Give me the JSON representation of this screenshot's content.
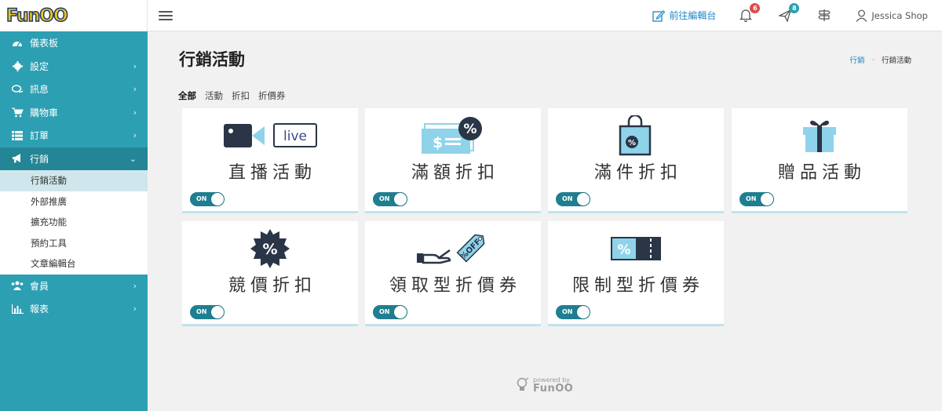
{
  "logo": {
    "text": "FunOO"
  },
  "sidebar": {
    "items": [
      {
        "label": "儀表板",
        "icon": "dashboard-icon",
        "has_children": false
      },
      {
        "label": "設定",
        "icon": "gear-icon",
        "has_children": true
      },
      {
        "label": "訊息",
        "icon": "chat-icon",
        "has_children": true
      },
      {
        "label": "購物車",
        "icon": "cart-icon",
        "has_children": true
      },
      {
        "label": "訂單",
        "icon": "list-icon",
        "has_children": true
      },
      {
        "label": "行銷",
        "icon": "megaphone-icon",
        "has_children": true,
        "open": true
      },
      {
        "label": "會員",
        "icon": "users-icon",
        "has_children": true
      },
      {
        "label": "報表",
        "icon": "bar-chart-icon",
        "has_children": true
      }
    ],
    "marketing_submenu": [
      {
        "label": "行銷活動",
        "active": true
      },
      {
        "label": "外部推廣"
      },
      {
        "label": "擴充功能"
      },
      {
        "label": "預約工具"
      },
      {
        "label": "文章編輯台"
      }
    ]
  },
  "topbar": {
    "editor_link": "前往編輯台",
    "notifications_count": "6",
    "messages_count": "8",
    "user_name": "Jessica Shop",
    "colors": {
      "notification_badge": "#e14b4b",
      "message_badge": "#2d9fb3"
    }
  },
  "page": {
    "title": "行銷活動",
    "breadcrumb": {
      "parent": "行銷",
      "separator": "-",
      "current": "行銷活動"
    },
    "filters": [
      "全部",
      "活動",
      "折扣",
      "折價券"
    ]
  },
  "cards": [
    {
      "title": "直播活動",
      "icon": "live-camera-icon",
      "live_label": "live",
      "toggle": "ON"
    },
    {
      "title": "滿額折扣",
      "icon": "money-percent-icon",
      "toggle": "ON"
    },
    {
      "title": "滿件折扣",
      "icon": "shopping-bag-percent-icon",
      "toggle": "ON"
    },
    {
      "title": "贈品活動",
      "icon": "gift-icon",
      "toggle": "ON"
    },
    {
      "title": "競價折扣",
      "icon": "percent-badge-icon",
      "toggle": "ON"
    },
    {
      "title": "領取型折價券",
      "icon": "hand-coupon-icon",
      "coupon_label": "%OFF",
      "toggle": "ON"
    },
    {
      "title": "限制型折價券",
      "icon": "ticket-percent-icon",
      "toggle": "ON"
    }
  ],
  "footer": {
    "powered_by": "powered by",
    "brand": "FunOO"
  },
  "colors": {
    "sidebar": "#2d9fb3",
    "accent": "#1e88c8",
    "toggle": "#1f7f90",
    "icon_dark": "#2a3547",
    "icon_light": "#8fd3ea"
  }
}
